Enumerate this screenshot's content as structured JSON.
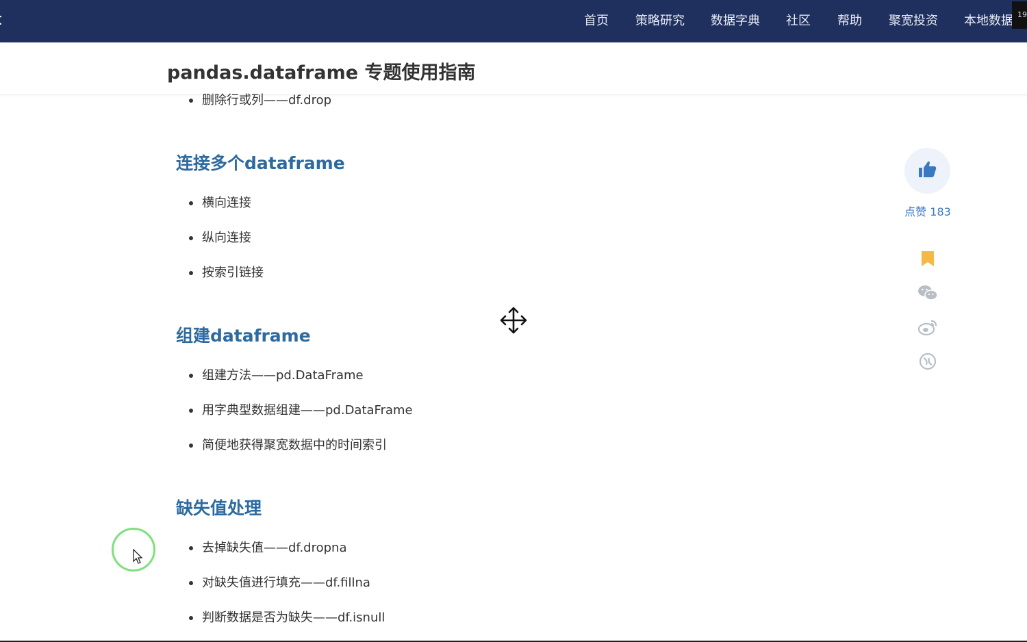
{
  "nav": {
    "items": [
      "首页",
      "策略研究",
      "数据字典",
      "社区",
      "帮助",
      "聚宽投资",
      "本地数据"
    ],
    "corner_badge": "19"
  },
  "header": {
    "title": "pandas.dataframe 专题使用指南"
  },
  "content": {
    "top_bullet": "删除行或列——df.drop",
    "sections": [
      {
        "heading": "连接多个dataframe",
        "items": [
          "横向连接",
          "纵向连接",
          "按索引链接"
        ]
      },
      {
        "heading": "组建dataframe",
        "items": [
          "组建方法——pd.DataFrame",
          "用字典型数据组建——pd.DataFrame",
          "简便地获得聚宽数据中的时间索引"
        ]
      },
      {
        "heading": "缺失值处理",
        "items": [
          "去掉缺失值——df.dropna",
          "对缺失值进行填充——df.fillna",
          "判断数据是否为缺失——df.isnull"
        ]
      }
    ]
  },
  "sidebar": {
    "like_label": "点赞 183",
    "icons": [
      "thumbs-up-icon",
      "bookmark-icon",
      "wechat-icon",
      "weibo-icon",
      "share-icon"
    ],
    "colors": {
      "like": "#3a78c2",
      "bookmark": "#f5b945",
      "muted": "#b9bec6"
    }
  },
  "theme": {
    "nav_bg": "#1f2f5e",
    "heading": "#2d6a9f"
  }
}
